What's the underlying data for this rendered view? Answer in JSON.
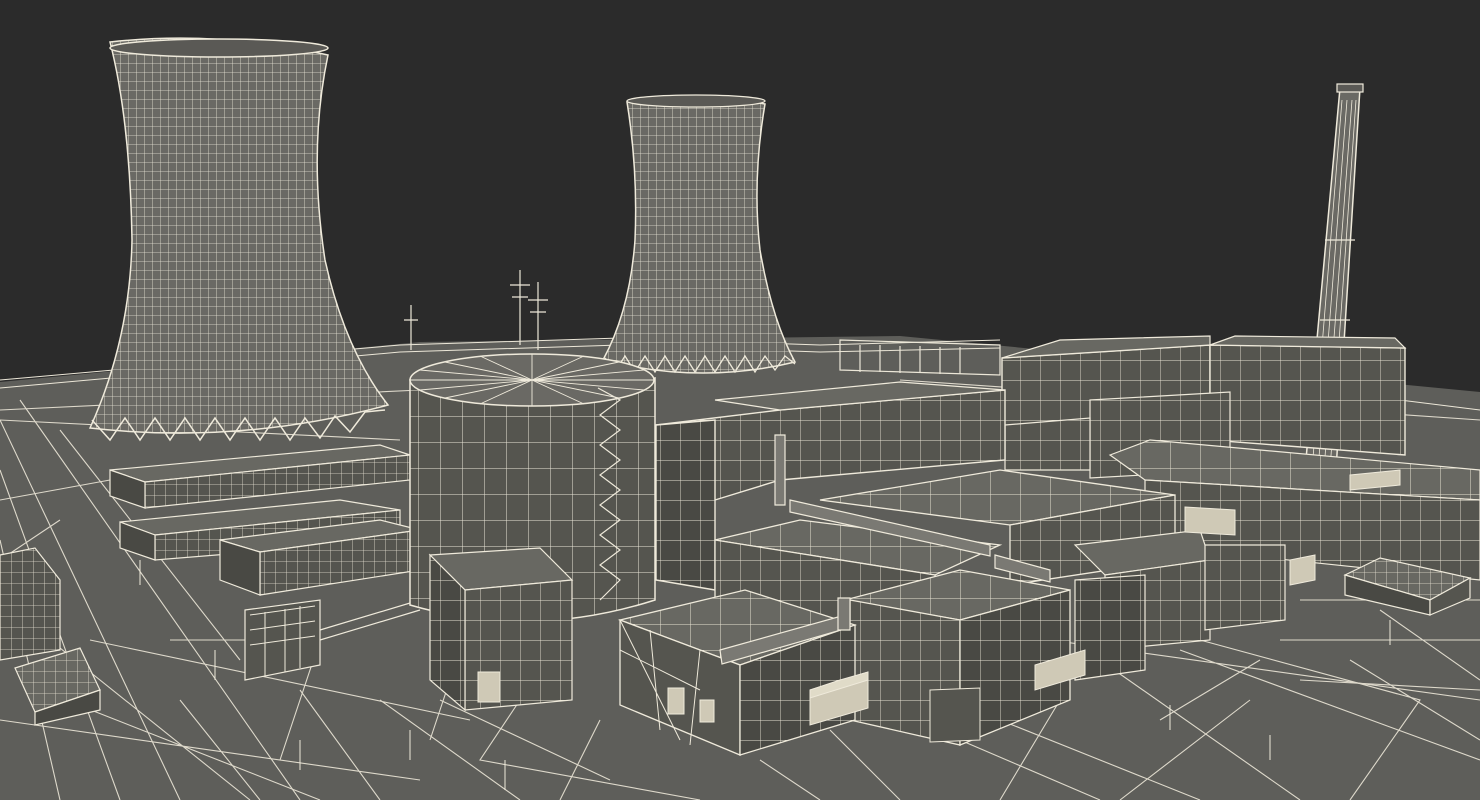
{
  "scene": {
    "subject": "wireframe-nuclear-power-plant",
    "palette": {
      "sky": "#2b2b2b",
      "ground": "#5e5e5a",
      "wire": "#efeadb",
      "building_side": "#55554f",
      "building_top": "#686862",
      "building_dark": "#494944",
      "tower_fill": "#6a6964",
      "pale_block": "#cfc9b6"
    }
  }
}
